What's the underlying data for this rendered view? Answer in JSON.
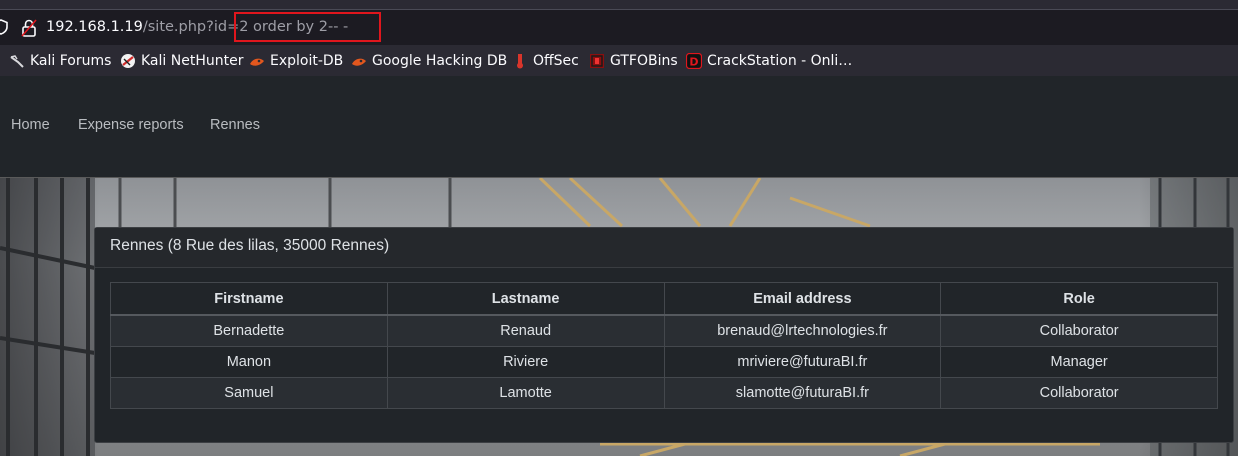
{
  "browser": {
    "url_host": "192.168.1.19",
    "url_path": "/site.php?id=2",
    "url_injection": " order by 2-- -",
    "bookmarks": [
      {
        "label": "Kali Forums",
        "icon": "kali-dragon-icon"
      },
      {
        "label": "Kali NetHunter",
        "icon": "nethunter-icon"
      },
      {
        "label": "Exploit-DB",
        "icon": "exploitdb-icon"
      },
      {
        "label": "Google Hacking DB",
        "icon": "ghdb-icon"
      },
      {
        "label": "OffSec",
        "icon": "offsec-icon"
      },
      {
        "label": "GTFOBins",
        "icon": "gtfobins-icon"
      },
      {
        "label": "CrackStation - Onli…",
        "icon": "crackstation-icon"
      }
    ]
  },
  "nav": {
    "items": [
      "Home",
      "Expense reports",
      "Rennes"
    ]
  },
  "card": {
    "title": "Rennes (8 Rue des lilas, 35000 Rennes)",
    "columns": [
      "Firstname",
      "Lastname",
      "Email address",
      "Role"
    ],
    "rows": [
      [
        "Bernadette",
        "Renaud",
        "brenaud@lrtechnologies.fr",
        "Collaborator"
      ],
      [
        "Manon",
        "Riviere",
        "mriviere@futuraBI.fr",
        "Manager"
      ],
      [
        "Samuel",
        "Lamotte",
        "slamotte@futuraBI.fr",
        "Collaborator"
      ]
    ]
  },
  "colors": {
    "highlight": "#e0161d",
    "nav_bg": "#212529",
    "card_bg": "#212529"
  }
}
